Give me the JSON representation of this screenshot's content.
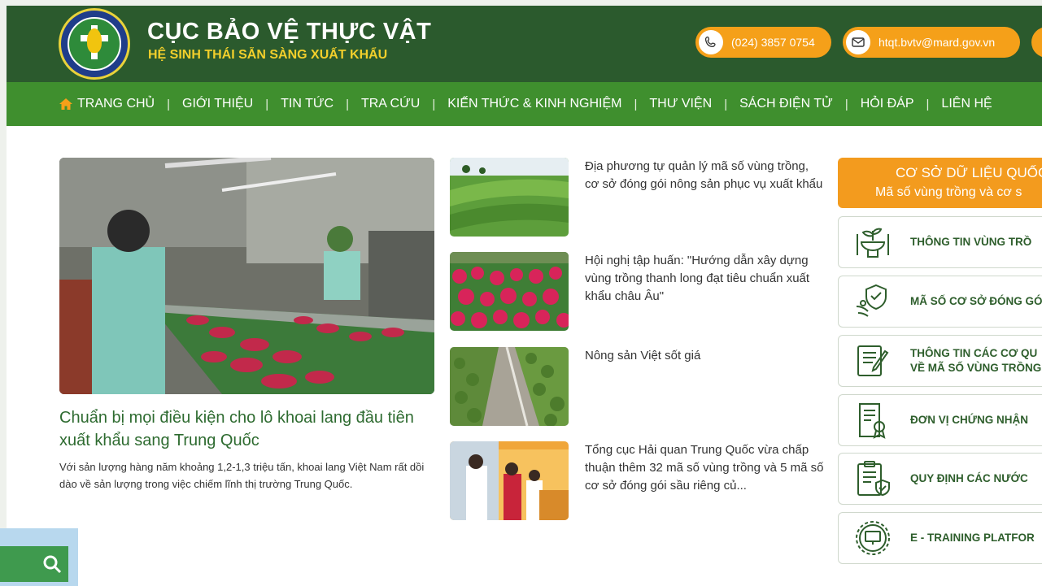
{
  "header": {
    "title": "CỤC BẢO VỆ THỰC VẬT",
    "subtitle": "HỆ SINH THÁI SẴN SÀNG XUẤT KHẨU",
    "logo_icon": "plant-protection-department-logo",
    "phone": "(024) 3857 0754",
    "email": "htqt.bvtv@mard.gov.vn",
    "accent": "#f5a019",
    "bg": "#2b5a2d"
  },
  "nav": {
    "items": [
      {
        "label": "TRANG CHỦ"
      },
      {
        "label": "GIỚI THIỆU"
      },
      {
        "label": "TIN TỨC"
      },
      {
        "label": "TRA CỨU"
      },
      {
        "label": "KIẾN THỨC & KINH NGHIỆM"
      },
      {
        "label": "THƯ VIỆN"
      },
      {
        "label": "SÁCH ĐIỆN TỬ"
      },
      {
        "label": "HỎI ĐÁP"
      },
      {
        "label": "LIÊN HỆ"
      }
    ],
    "separator": "|",
    "bg": "#3f8f2e"
  },
  "featured": {
    "title": "Chuẩn bị mọi điều kiện cho lô khoai lang đầu tiên xuất khẩu sang Trung Quốc",
    "description": "Với sản lượng hàng năm khoảng 1,2-1,3 triệu tấn, khoai lang Việt Nam rất dồi dào về sản lượng trong việc chiếm lĩnh thị trường Trung Quốc."
  },
  "news": [
    {
      "title": "Địa phương tự quản lý mã số vùng trồng, cơ sở đóng gói nông sản phục vụ xuất khẩu"
    },
    {
      "title": "Hội nghị tập huấn: \"Hướng dẫn xây dựng vùng trồng thanh long đạt tiêu chuẩn xuất khẩu châu Âu\""
    },
    {
      "title": "Nông sản Việt sốt giá"
    },
    {
      "title": "Tổng cục Hải quan Trung Quốc vừa chấp thuận thêm 32 mã số vùng trồng và 5 mã số cơ sở đóng gói sầu riêng củ..."
    }
  ],
  "database": {
    "line1": "CƠ SỞ DỮ LIỆU QUỐC",
    "line2": "Mã số vùng trồng và cơ s"
  },
  "menu": [
    {
      "label": "THÔNG TIN VÙNG TRỒ",
      "icon": "plant-bowl-icon"
    },
    {
      "label": "MÃ SỐ CƠ SỞ ĐÓNG GÓ",
      "icon": "shield-seedling-icon"
    },
    {
      "label": "THÔNG TIN CÁC CƠ QU",
      "label2": "VỀ MÃ SỐ VÙNG TRỒNG",
      "icon": "document-pen-icon"
    },
    {
      "label": "ĐƠN VỊ CHỨNG NHẬN",
      "icon": "certificate-icon"
    },
    {
      "label": "QUY ĐỊNH CÁC NƯỚC",
      "icon": "checklist-shield-icon"
    },
    {
      "label": "E - TRAINING PLATFOR",
      "icon": "training-gear-icon"
    }
  ],
  "search_widget": {
    "icon": "search-icon"
  }
}
